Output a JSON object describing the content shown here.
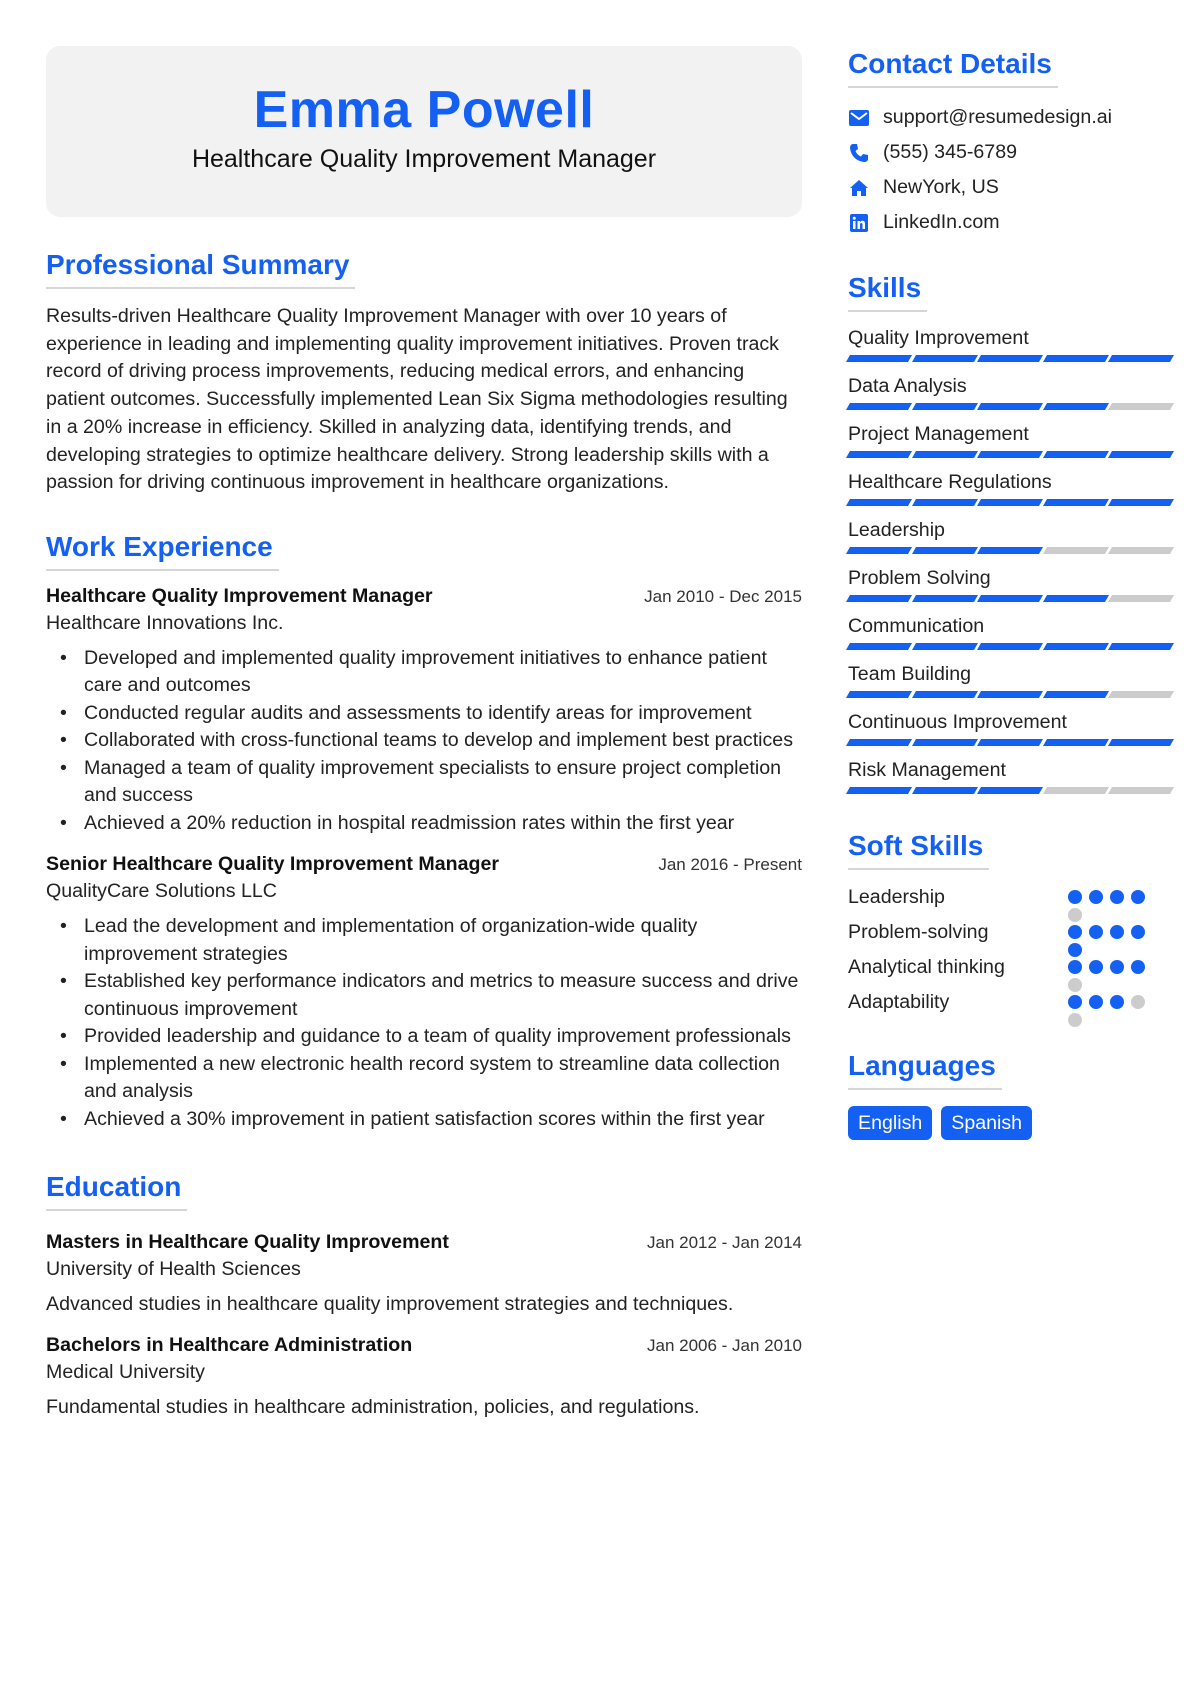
{
  "header": {
    "name": "Emma Powell",
    "role": "Healthcare Quality Improvement Manager"
  },
  "summary": {
    "title": "Professional Summary",
    "text": "Results-driven Healthcare Quality Improvement Manager with over 10 years of experience in leading and implementing quality improvement initiatives. Proven track record of driving process improvements, reducing medical errors, and enhancing patient outcomes. Successfully implemented Lean Six Sigma methodologies resulting in a 20% increase in efficiency. Skilled in analyzing data, identifying trends, and developing strategies to optimize healthcare delivery. Strong leadership skills with a passion for driving continuous improvement in healthcare organizations."
  },
  "experience": {
    "title": "Work Experience",
    "jobs": [
      {
        "title": "Healthcare Quality Improvement Manager",
        "dates": "Jan 2010 - Dec 2015",
        "company": "Healthcare Innovations Inc.",
        "bullets": [
          "Developed and implemented quality improvement initiatives to enhance patient care and outcomes",
          "Conducted regular audits and assessments to identify areas for improvement",
          "Collaborated with cross-functional teams to develop and implement best practices",
          "Managed a team of quality improvement specialists to ensure project completion and success",
          "Achieved a 20% reduction in hospital readmission rates within the first year"
        ]
      },
      {
        "title": "Senior Healthcare Quality Improvement Manager",
        "dates": "Jan 2016 - Present",
        "company": "QualityCare Solutions LLC",
        "bullets": [
          "Lead the development and implementation of organization-wide quality improvement strategies",
          "Established key performance indicators and metrics to measure success and drive continuous improvement",
          "Provided leadership and guidance to a team of quality improvement professionals",
          "Implemented a new electronic health record system to streamline data collection and analysis",
          "Achieved a 30% improvement in patient satisfaction scores within the first year"
        ]
      }
    ]
  },
  "education": {
    "title": "Education",
    "items": [
      {
        "degree": "Masters in Healthcare Quality Improvement",
        "dates": "Jan 2012 - Jan 2014",
        "school": "University of Health Sciences",
        "description": "Advanced studies in healthcare quality improvement strategies and techniques."
      },
      {
        "degree": "Bachelors in Healthcare Administration",
        "dates": "Jan 2006 - Jan 2010",
        "school": "Medical University",
        "description": "Fundamental studies in healthcare administration, policies, and regulations."
      }
    ]
  },
  "contact": {
    "title": "Contact Details",
    "items": [
      {
        "icon": "envelope-icon",
        "text": "support@resumedesign.ai"
      },
      {
        "icon": "phone-icon",
        "text": "(555) 345-6789"
      },
      {
        "icon": "home-icon",
        "text": "NewYork, US"
      },
      {
        "icon": "linkedin-icon",
        "text": "LinkedIn.com"
      }
    ]
  },
  "skills": {
    "title": "Skills",
    "max": 5,
    "items": [
      {
        "name": "Quality Improvement",
        "level": 5
      },
      {
        "name": "Data Analysis",
        "level": 4
      },
      {
        "name": "Project Management",
        "level": 5
      },
      {
        "name": "Healthcare Regulations",
        "level": 5
      },
      {
        "name": "Leadership",
        "level": 3
      },
      {
        "name": "Problem Solving",
        "level": 4
      },
      {
        "name": "Communication",
        "level": 5
      },
      {
        "name": "Team Building",
        "level": 4
      },
      {
        "name": "Continuous Improvement",
        "level": 5
      },
      {
        "name": "Risk Management",
        "level": 3
      }
    ]
  },
  "soft_skills": {
    "title": "Soft Skills",
    "max": 5,
    "items": [
      {
        "name": "Leadership",
        "level": 4
      },
      {
        "name": "Problem-solving",
        "level": 5
      },
      {
        "name": "Analytical thinking",
        "level": 4
      },
      {
        "name": "Adaptability",
        "level": 3
      }
    ]
  },
  "languages": {
    "title": "Languages",
    "items": [
      "English",
      "Spanish"
    ]
  },
  "colors": {
    "accent": "#1460f2",
    "inactive": "#cccccc",
    "header_bg": "#f2f2f2"
  }
}
